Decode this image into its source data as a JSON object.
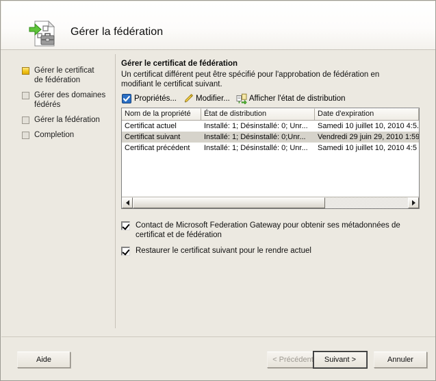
{
  "window": {
    "title": "Gérer la fédération",
    "header_icon": "federation-document-briefcase-icon"
  },
  "sidebar": {
    "items": [
      {
        "label": "Gérer le certificat\nde fédération",
        "icon": "current-step-box-icon",
        "state": "current"
      },
      {
        "label": "Gérer des domaines\nfédérés",
        "icon": "step-box-icon",
        "state": "pending"
      },
      {
        "label": "Gérer la fédération",
        "icon": "step-box-icon",
        "state": "pending"
      },
      {
        "label": "Completion",
        "icon": "step-box-icon",
        "state": "pending"
      }
    ]
  },
  "main": {
    "heading": "Gérer le certificat de fédération",
    "description": "Un certificat différent peut être spécifié pour l'approbation de fédération en modifiant le certificat suivant.",
    "commands": [
      {
        "label": "Propriétés...",
        "icon": "properties-checkbox-icon"
      },
      {
        "label": "Modifier...",
        "icon": "pencil-edit-icon"
      },
      {
        "label": "Afficher l'état de distribution",
        "icon": "distribution-status-icon"
      }
    ],
    "table": {
      "columns": [
        "Nom de la propriété",
        "État de distribution",
        "Date d'expiration"
      ],
      "rows": [
        {
          "name": "Certificat actuel",
          "status": "Installé: 1; Désinstallé: 0; Unr...",
          "expiry": "Samedi 10 juillet 10, 2010 4:5...",
          "selected": false
        },
        {
          "name": "Certificat suivant",
          "status": "Installé: 1; Désinstallé: 0;Unr...",
          "expiry": "Vendredi 29 juin 29, 2010  1:59...",
          "selected": true
        },
        {
          "name": "Certificat précédent",
          "status": "Installé: 1; Désinstallé: 0; Unr...",
          "expiry": "Samedi 10 juillet  10, 2010   4:5",
          "selected": false
        }
      ],
      "scrollbar": {
        "orientation": "horizontal",
        "thumb_fraction_percent": 70
      }
    },
    "options": [
      {
        "label": "Contact de Microsoft Federation Gateway pour obtenir ses métadonnées de certificat et de fédération",
        "checked": true
      },
      {
        "label": "Restaurer le certificat suivant pour le rendre actuel",
        "checked": true
      }
    ]
  },
  "footer": {
    "help": "Aide",
    "previous": "< Précédent",
    "next": "Suivant >",
    "cancel": "Annuler"
  },
  "colors": {
    "dialog_background": "#ece9e1",
    "header_background": "#ffffff",
    "selected_row": "#d6d3cb",
    "current_step_accent": "#f2c416",
    "list_background": "#ffffff"
  }
}
